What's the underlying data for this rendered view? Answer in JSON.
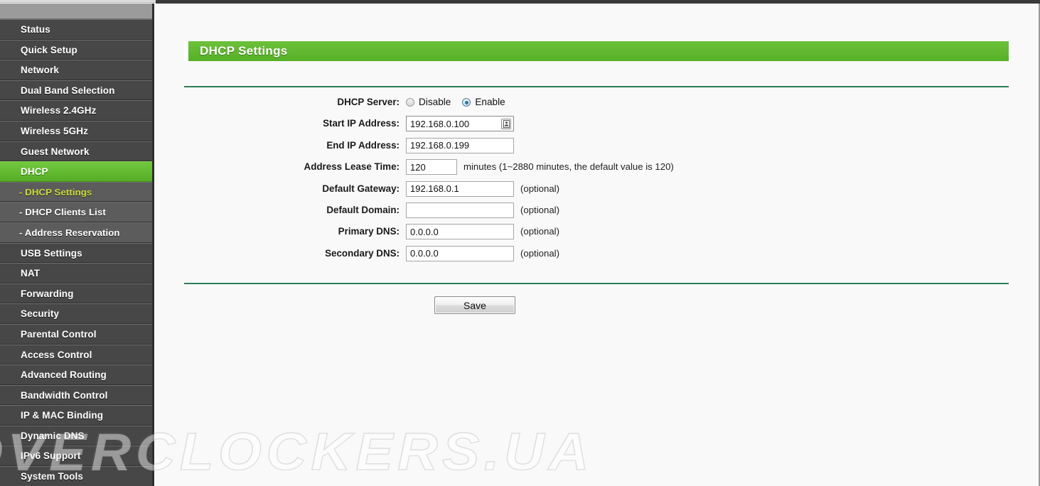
{
  "sidebar": {
    "items": [
      {
        "label": "Status",
        "type": "main",
        "state": "normal"
      },
      {
        "label": "Quick Setup",
        "type": "main",
        "state": "normal"
      },
      {
        "label": "Network",
        "type": "main",
        "state": "normal"
      },
      {
        "label": "Dual Band Selection",
        "type": "main",
        "state": "normal"
      },
      {
        "label": "Wireless 2.4GHz",
        "type": "main",
        "state": "normal"
      },
      {
        "label": "Wireless 5GHz",
        "type": "main",
        "state": "normal"
      },
      {
        "label": "Guest Network",
        "type": "main",
        "state": "normal"
      },
      {
        "label": "DHCP",
        "type": "main",
        "state": "active"
      },
      {
        "label": "- DHCP Settings",
        "type": "sub",
        "state": "sub-active"
      },
      {
        "label": "- DHCP Clients List",
        "type": "sub",
        "state": "normal"
      },
      {
        "label": "- Address Reservation",
        "type": "sub",
        "state": "normal"
      },
      {
        "label": "USB Settings",
        "type": "main",
        "state": "normal"
      },
      {
        "label": "NAT",
        "type": "main",
        "state": "normal"
      },
      {
        "label": "Forwarding",
        "type": "main",
        "state": "normal"
      },
      {
        "label": "Security",
        "type": "main",
        "state": "normal"
      },
      {
        "label": "Parental Control",
        "type": "main",
        "state": "normal"
      },
      {
        "label": "Access Control",
        "type": "main",
        "state": "normal"
      },
      {
        "label": "Advanced Routing",
        "type": "main",
        "state": "normal"
      },
      {
        "label": "Bandwidth Control",
        "type": "main",
        "state": "normal"
      },
      {
        "label": "IP & MAC Binding",
        "type": "main",
        "state": "normal"
      },
      {
        "label": "Dynamic DNS",
        "type": "main",
        "state": "normal"
      },
      {
        "label": "IPv6 Support",
        "type": "main",
        "state": "normal"
      },
      {
        "label": "System Tools",
        "type": "main",
        "state": "normal"
      }
    ]
  },
  "panel": {
    "title": "DHCP Settings"
  },
  "form": {
    "dhcp_server": {
      "label": "DHCP Server:",
      "options": [
        {
          "label": "Disable",
          "selected": false
        },
        {
          "label": "Enable",
          "selected": true
        }
      ]
    },
    "start_ip": {
      "label": "Start IP Address:",
      "value": "192.168.0.100",
      "placeholder": "",
      "icon": "autofill-contact-icon"
    },
    "end_ip": {
      "label": "End IP Address:",
      "value": "192.168.0.199",
      "placeholder": ""
    },
    "lease_time": {
      "label": "Address Lease Time:",
      "value": "120",
      "placeholder": "",
      "hint": "minutes (1~2880 minutes, the default value is 120)"
    },
    "default_gateway": {
      "label": "Default Gateway:",
      "value": "192.168.0.1",
      "placeholder": "",
      "hint": "(optional)"
    },
    "default_domain": {
      "label": "Default Domain:",
      "value": "",
      "placeholder": "",
      "hint": "(optional)"
    },
    "primary_dns": {
      "label": "Primary DNS:",
      "value": "0.0.0.0",
      "placeholder": "",
      "hint": "(optional)"
    },
    "secondary_dns": {
      "label": "Secondary DNS:",
      "value": "0.0.0.0",
      "placeholder": "",
      "hint": "(optional)"
    },
    "save_label": "Save"
  },
  "watermark": {
    "text": "OVERCLOCKERS.UA"
  },
  "colors": {
    "accent_green": "#61bb30",
    "sidebar_bg": "#474747",
    "sidebar_sub_bg": "#5c5c5c",
    "sub_active_text": "#cddb3c",
    "rule_green": "#2e7d57",
    "content_bg": "#f9f9f9"
  }
}
